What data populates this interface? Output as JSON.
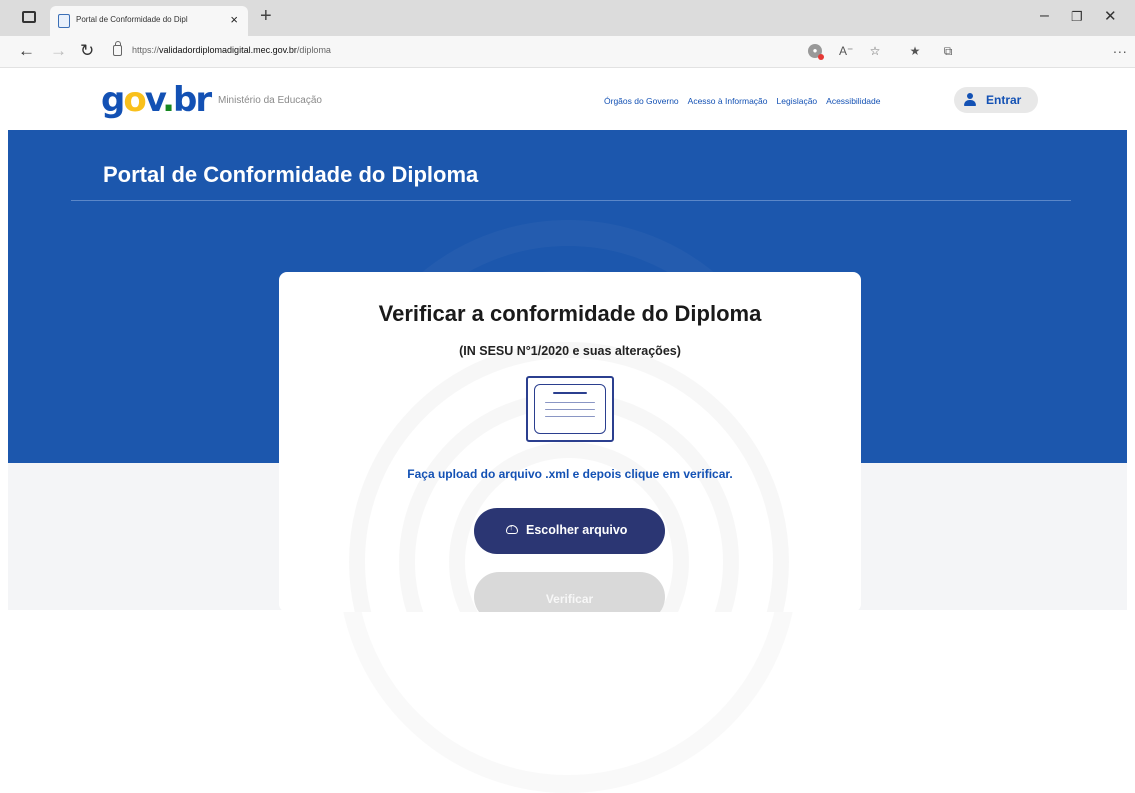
{
  "browser": {
    "tab_title": "Portal de Conformidade do Dipl",
    "tab_close": "×",
    "new_tab": "+",
    "url_prefix": "https://",
    "url_domain": "validadordiplomadigital.mec.gov.br",
    "url_path": "/diploma",
    "more": "..."
  },
  "header": {
    "logo": {
      "g": "g",
      "o": "o",
      "v": "v",
      "dot": ".",
      "b": "b",
      "r": "r"
    },
    "ministry": "Ministério da Educação",
    "links": [
      "Órgãos do Governo",
      "Acesso à Informação",
      "Legislação",
      "Acessibilidade"
    ],
    "login_label": "Entrar"
  },
  "hero": {
    "title": "Portal de Conformidade do Diploma"
  },
  "card": {
    "title": "Verificar a conformidade do Diploma",
    "subtitle": "(IN SESU N°1/2020 e suas alterações)",
    "instruction": "Faça upload do arquivo .xml e depois clique em verificar.",
    "choose_file_label": "Escolher arquivo",
    "verify_label": "Verificar"
  },
  "colors": {
    "hero_blue": "#1c57ad",
    "link_blue": "#1351b4",
    "button_navy": "#2b3673",
    "disabled_gray": "#d9d9d9",
    "logo_yellow": "#f9c01c",
    "logo_green": "#168821"
  },
  "icons": [
    "tab-actions-icon",
    "page-favicon-icon",
    "back-arrow-icon",
    "forward-arrow-icon",
    "reload-icon",
    "lock-icon",
    "tracking-blocked-icon",
    "read-aloud-icon",
    "add-favorite-icon",
    "favorites-icon",
    "collections-icon",
    "user-icon",
    "diploma-icon",
    "cloud-upload-icon"
  ]
}
